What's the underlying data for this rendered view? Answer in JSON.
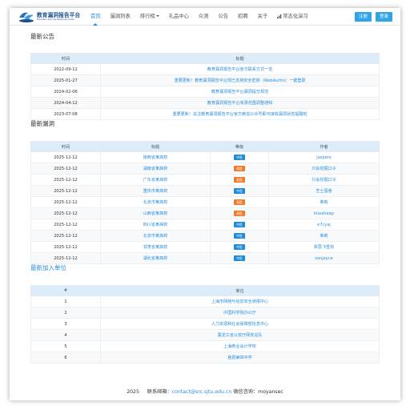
{
  "brand": {
    "name_cn": "教育漏洞报告平台",
    "name_en": "Education Security Response Center"
  },
  "nav": {
    "items": [
      "首页",
      "漏洞列表",
      "排行榜",
      "礼品中心",
      "众测",
      "公告",
      "招聘",
      "关于",
      "常态化演习"
    ],
    "register": "注册",
    "login": "登录"
  },
  "notices": {
    "title": "最新公告",
    "headers": [
      "时间",
      "标题"
    ],
    "rows": [
      [
        "2022-09-12",
        "教育漏洞报告平台官方联系方式一览"
      ],
      [
        "2025-01-27",
        "重要更新！教育漏洞报告平台现已支持安全密钥（WebAuthn）一键登录"
      ],
      [
        "2024-02-06",
        "教育漏洞报告平台漏洞提交规范"
      ],
      [
        "2024-04-12",
        "教育漏洞报告平台收录范围调整通知"
      ],
      [
        "2023-07-08",
        "重要更新！关注教育漏洞报告平台官方微信公众号即可接收漏洞状态提醒啦"
      ]
    ]
  },
  "vulns": {
    "title": "最新漏洞",
    "headers": [
      "时间",
      "标题",
      "等级",
      "作者"
    ],
    "rows": [
      {
        "date": "2025-12-12",
        "title": "陕西省某高校",
        "level": "中危",
        "level_color": "#1e8bd6",
        "author": "Jasperx"
      },
      {
        "date": "2025-12-12",
        "title": "湖南省某高校",
        "level": "高危",
        "level_color": "#f07a2c",
        "author": "只会挖掘口令"
      },
      {
        "date": "2025-12-12",
        "title": "广东省某高校",
        "level": "高危",
        "level_color": "#f07a2c",
        "author": "只会挖掘口令"
      },
      {
        "date": "2025-12-12",
        "title": "重庆市某高校",
        "level": "中危",
        "level_color": "#1e8bd6",
        "author": "芝士蛋卷"
      },
      {
        "date": "2025-12-12",
        "title": "北京市某高校",
        "level": "高危",
        "level_color": "#f07a2c",
        "author": "茉莉"
      },
      {
        "date": "2025-12-12",
        "title": "山西省某高校",
        "level": "高危",
        "level_color": "#f07a2c",
        "author": "kisssheep"
      },
      {
        "date": "2025-12-12",
        "title": "四川省某高校",
        "level": "中危",
        "level_color": "#1e8bd6",
        "author": "e7cyaj"
      },
      {
        "date": "2025-12-12",
        "title": "北京市某高校",
        "level": "中危",
        "level_color": "#1e8bd6",
        "author": "茉莉"
      },
      {
        "date": "2025-12-12",
        "title": "甘肃省某高校",
        "level": "中危",
        "level_color": "#1e8bd6",
        "author": "翠荔飞雪剑"
      },
      {
        "date": "2025-12-12",
        "title": "湖北省某高校",
        "level": "中危",
        "level_color": "#1e8bd6",
        "author": "sonjayce"
      }
    ]
  },
  "units": {
    "title": "最新加入单位",
    "headers": [
      "#",
      "单位"
    ],
    "rows": [
      [
        "1",
        "上海市网络与信息安全通报中心"
      ],
      [
        "2",
        "中国科学院办公厅"
      ],
      [
        "3",
        "人力资源和社会保障部信息中心"
      ],
      [
        "4",
        "黑龙江省公安厅网安总队"
      ],
      [
        "5",
        "上海商业会计学校"
      ],
      [
        "6",
        "莒县第四中学"
      ]
    ]
  },
  "footer": {
    "year": "2025",
    "mail_label": "联系邮箱：",
    "mail": "contact@src.sjtu.edu.cn",
    "wechat": "微信咨询：moyansec"
  },
  "colors": {
    "accent": "#2a8ddb",
    "high": "#f07a2c",
    "medium": "#1e8bd6",
    "header_bg": "#dcecf8"
  }
}
